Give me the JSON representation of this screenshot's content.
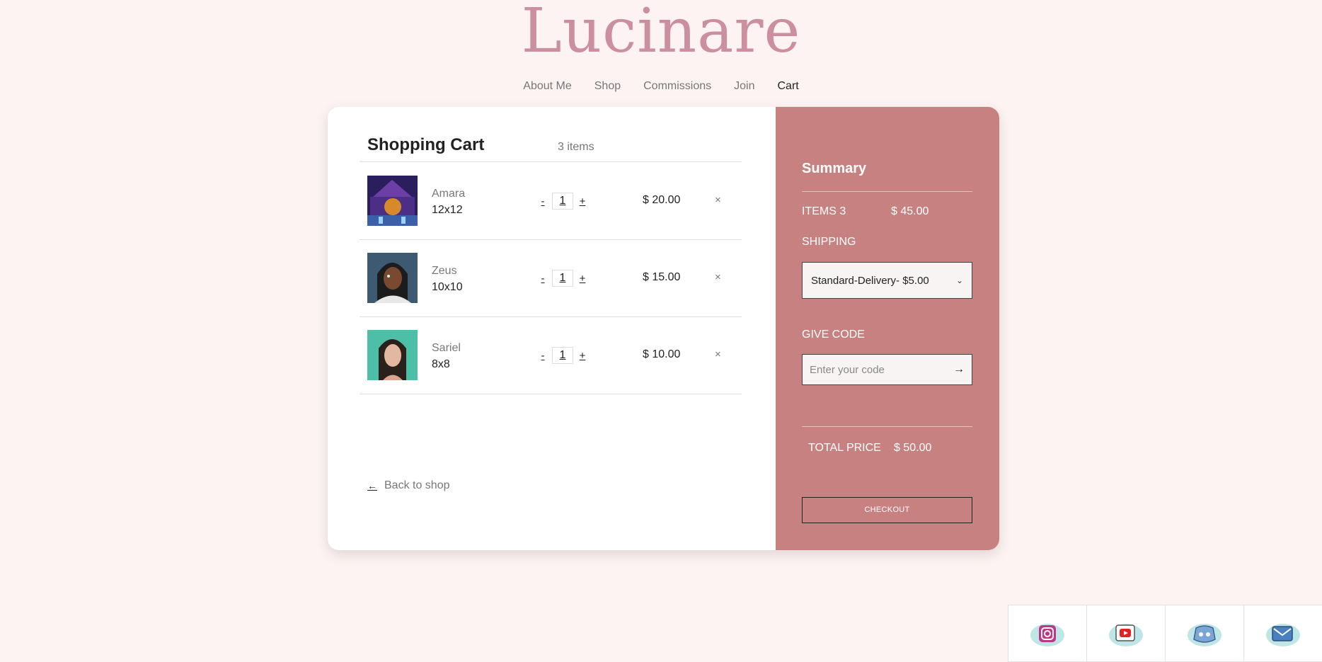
{
  "brand": {
    "name": "Lucinare"
  },
  "nav": [
    {
      "label": "About Me"
    },
    {
      "label": "Shop"
    },
    {
      "label": "Commissions"
    },
    {
      "label": "Join"
    },
    {
      "label": "Cart"
    }
  ],
  "cart": {
    "title": "Shopping Cart",
    "count": "3 items",
    "items": [
      {
        "name": "Amara",
        "size": "12x12",
        "qty": "1",
        "price": "$ 20.00"
      },
      {
        "name": "Zeus",
        "size": "10x10",
        "qty": "1",
        "price": "$ 15.00"
      },
      {
        "name": "Sariel",
        "size": "8x8",
        "qty": "1",
        "price": "$ 10.00"
      }
    ],
    "minus": "-",
    "plus": "+",
    "remove": "×",
    "back_arrow": "←",
    "back_label": "Back to shop"
  },
  "summary": {
    "title": "Summary",
    "items_label": "ITEMS 3",
    "items_value": "$ 45.00",
    "shipping_label": "SHIPPING",
    "shipping_selected": "Standard-Delivery- $5.00",
    "code_label": "GIVE CODE",
    "code_placeholder": "Enter your code",
    "code_arrow": "→",
    "total_label": "TOTAL PRICE",
    "total_value": "$ 50.00",
    "checkout": "CHECKOUT"
  },
  "social": [
    {
      "icon": "instagram-icon"
    },
    {
      "icon": "youtube-icon"
    },
    {
      "icon": "discord-icon"
    },
    {
      "icon": "mail-icon"
    }
  ],
  "colors": {
    "background": "#fdf3f2",
    "logo": "#cc8f9f",
    "summary": "#c88181"
  }
}
